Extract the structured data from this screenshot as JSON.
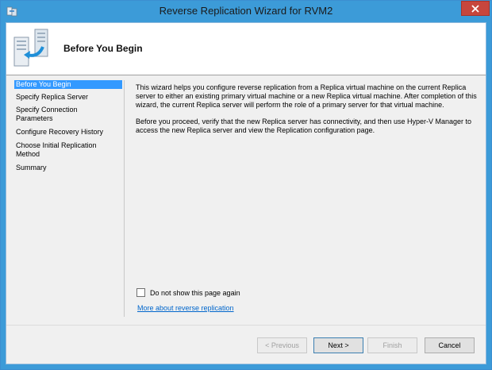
{
  "window": {
    "title": "Reverse Replication Wizard for RVM2",
    "close_glyph": "✕",
    "accent_color": "#3c9bd8",
    "close_color": "#c7463d"
  },
  "header": {
    "title": "Before You Begin",
    "icon": "server-replication-icon"
  },
  "nav": {
    "items": [
      {
        "label": "Before You Begin",
        "selected": true
      },
      {
        "label": "Specify Replica Server",
        "selected": false
      },
      {
        "label": "Specify Connection Parameters",
        "selected": false
      },
      {
        "label": "Configure Recovery History",
        "selected": false
      },
      {
        "label": "Choose Initial Replication Method",
        "selected": false
      },
      {
        "label": "Summary",
        "selected": false
      }
    ],
    "selected_color": "#3399ff"
  },
  "content": {
    "paragraph1": "This wizard helps you configure reverse replication from a Replica virtual machine on the current Replica server to either an existing primary virtual machine or a new Replica virtual machine. After completion of this wizard, the current Replica server will perform the role of a primary server for that virtual machine.",
    "paragraph2": "Before you proceed, verify that the new Replica server has connectivity, and then use Hyper-V Manager to access the new Replica server and view the Replication configuration page.",
    "checkbox_label": "Do not show this page again",
    "checkbox_checked": false,
    "link_text": "More about reverse replication"
  },
  "buttons": {
    "previous": "< Previous",
    "next": "Next >",
    "finish": "Finish",
    "cancel": "Cancel"
  }
}
